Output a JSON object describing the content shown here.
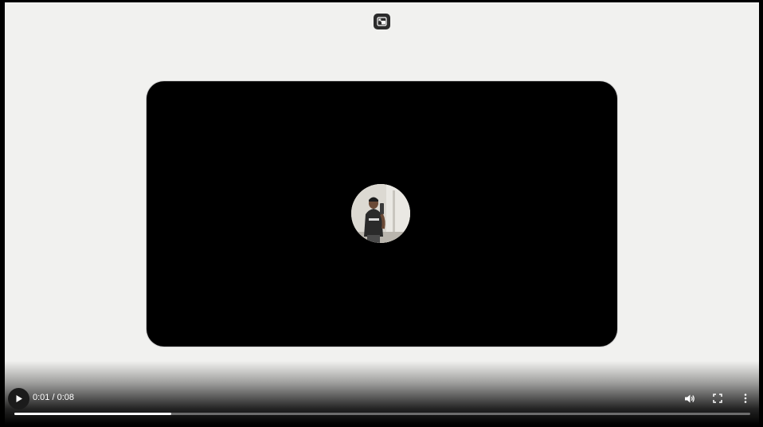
{
  "player": {
    "current_time": "0:01",
    "separator": " / ",
    "duration": "0:08",
    "progress_fraction": 0.213
  },
  "icons": {
    "picture_in_picture": "picture-in-picture-icon",
    "play": "play-icon",
    "volume": "volume-icon",
    "fullscreen": "fullscreen-icon",
    "more": "more-vertical-icon"
  },
  "colors": {
    "surface": "#f1f1ef",
    "card": "#000000",
    "control_text": "#ffffff",
    "track": "#6d6d6d",
    "fill": "#ffffff"
  }
}
